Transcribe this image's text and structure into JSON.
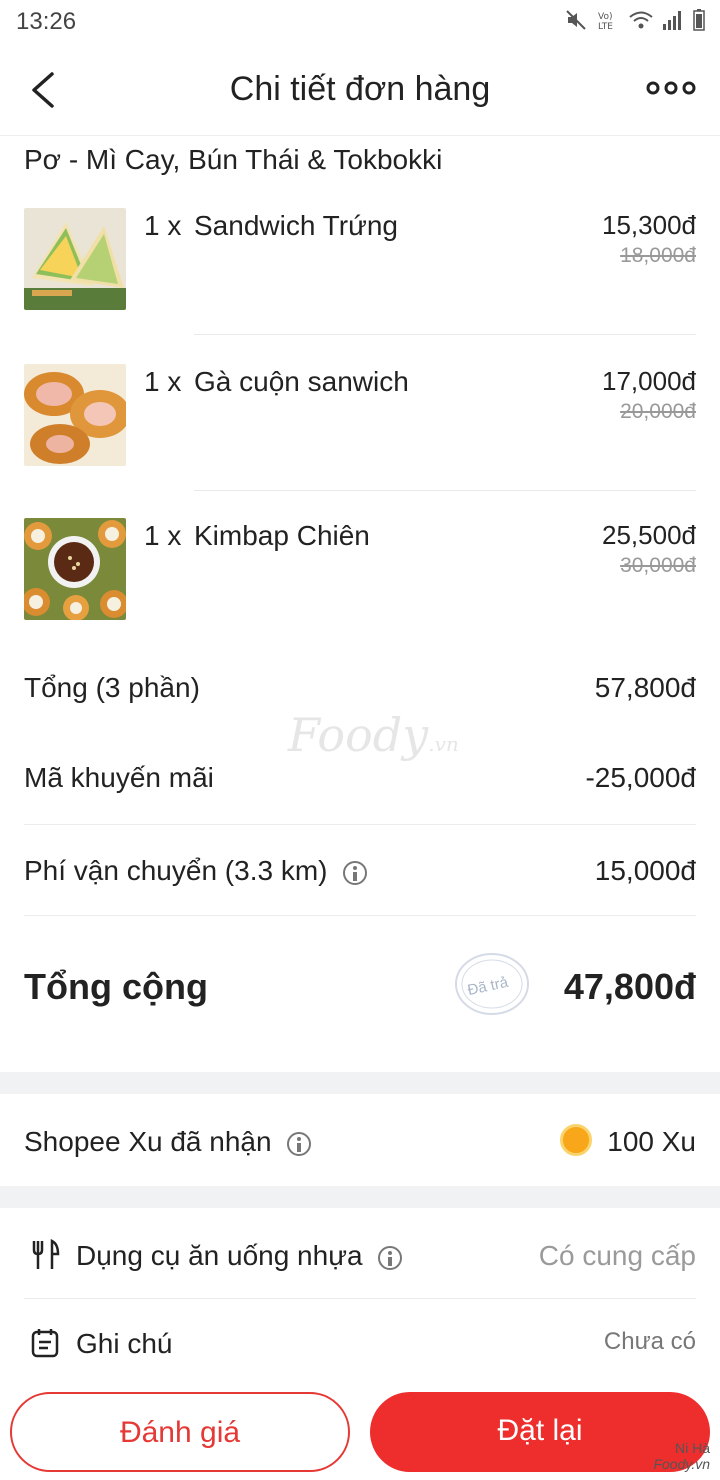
{
  "status_bar": {
    "time": "13:26",
    "icons": [
      "mute-icon",
      "volte-icon",
      "wifi-icon",
      "signal-icon",
      "battery-icon"
    ]
  },
  "header": {
    "title": "Chi tiết đơn hàng"
  },
  "shop": {
    "name": "Pơ - Mì Cay, Bún Thái & Tokbokki"
  },
  "items": [
    {
      "qty": "1 x",
      "name": "Sandwich Trứng",
      "price": "15,300đ",
      "old_price": "18,000đ"
    },
    {
      "qty": "1 x",
      "name": "Gà cuộn sanwich",
      "price": "17,000đ",
      "old_price": "20,000đ"
    },
    {
      "qty": "1 x",
      "name": "Kimbap Chiên",
      "price": "25,500đ",
      "old_price": "30,000đ"
    }
  ],
  "summary": {
    "subtotal_label": "Tổng (3 phần)",
    "subtotal_value": "57,800đ",
    "promo_label": "Mã khuyến mãi",
    "promo_value": "-25,000đ",
    "shipping_label": "Phí vận chuyển (3.3 km)",
    "shipping_value": "15,000đ",
    "total_label": "Tổng cộng",
    "total_value": "47,800đ",
    "paid_stamp": "Đã trả"
  },
  "watermark": {
    "brand": "Foody",
    "suffix": ".vn"
  },
  "shopee_xu": {
    "label": "Shopee Xu đã nhận",
    "value": "100 Xu"
  },
  "options": {
    "utensils_label": "Dụng cụ ăn uống nhựa",
    "utensils_value": "Có cung cấp",
    "note_label": "Ghi chú",
    "note_value": "Chưa có"
  },
  "actions": {
    "rate_label": "Đánh giá",
    "reorder_label": "Đặt lại"
  },
  "corner_mark": {
    "name": "Ni Hà",
    "brand": "Foody.vn"
  },
  "colors": {
    "accent": "#ee2d2d",
    "coin": "#f8a61a",
    "muted": "#9a9a9a"
  }
}
